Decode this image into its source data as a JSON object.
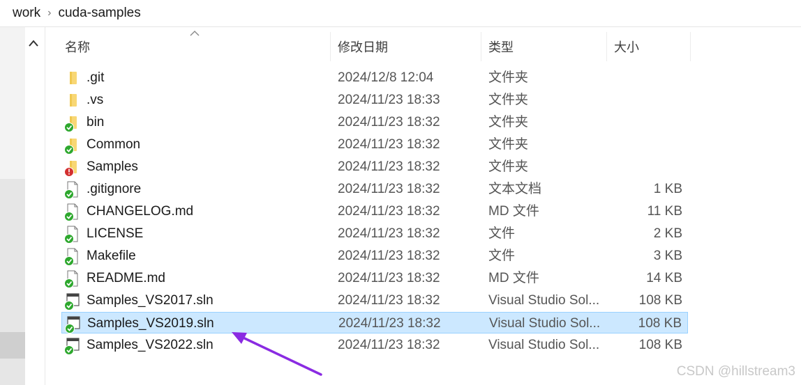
{
  "breadcrumb": {
    "items": [
      "work",
      "cuda-samples"
    ]
  },
  "columns": {
    "name": "名称",
    "date": "修改日期",
    "type": "类型",
    "size": "大小"
  },
  "files": [
    {
      "name": ".git",
      "date": "2024/12/8 12:04",
      "type": "文件夹",
      "size": "",
      "icon": "folder-icon"
    },
    {
      "name": ".vs",
      "date": "2024/11/23 18:33",
      "type": "文件夹",
      "size": "",
      "icon": "folder-icon"
    },
    {
      "name": "bin",
      "date": "2024/11/23 18:32",
      "type": "文件夹",
      "size": "",
      "icon": "folder-synced-icon"
    },
    {
      "name": "Common",
      "date": "2024/11/23 18:32",
      "type": "文件夹",
      "size": "",
      "icon": "folder-synced-icon"
    },
    {
      "name": "Samples",
      "date": "2024/11/23 18:32",
      "type": "文件夹",
      "size": "",
      "icon": "folder-error-icon"
    },
    {
      "name": ".gitignore",
      "date": "2024/11/23 18:32",
      "type": "文本文档",
      "size": "1 KB",
      "icon": "file-synced-icon"
    },
    {
      "name": "CHANGELOG.md",
      "date": "2024/11/23 18:32",
      "type": "MD 文件",
      "size": "11 KB",
      "icon": "file-synced-icon"
    },
    {
      "name": "LICENSE",
      "date": "2024/11/23 18:32",
      "type": "文件",
      "size": "2 KB",
      "icon": "file-synced-icon"
    },
    {
      "name": "Makefile",
      "date": "2024/11/23 18:32",
      "type": "文件",
      "size": "3 KB",
      "icon": "file-synced-icon"
    },
    {
      "name": "README.md",
      "date": "2024/11/23 18:32",
      "type": "MD 文件",
      "size": "14 KB",
      "icon": "file-synced-icon"
    },
    {
      "name": "Samples_VS2017.sln",
      "date": "2024/11/23 18:32",
      "type": "Visual Studio Sol...",
      "size": "108 KB",
      "icon": "sln-synced-icon"
    },
    {
      "name": "Samples_VS2019.sln",
      "date": "2024/11/23 18:32",
      "type": "Visual Studio Sol...",
      "size": "108 KB",
      "icon": "sln-synced-icon",
      "selected": true
    },
    {
      "name": "Samples_VS2022.sln",
      "date": "2024/11/23 18:32",
      "type": "Visual Studio Sol...",
      "size": "108 KB",
      "icon": "sln-synced-icon"
    }
  ],
  "watermark": "CSDN @hillstream3",
  "colors": {
    "selection": "#cce8ff",
    "selection_border": "#99d1ff",
    "arrow": "#8a2be2",
    "sync_green": "#2ea82e",
    "error_red": "#d32f2f",
    "folder": "#f8d775"
  }
}
